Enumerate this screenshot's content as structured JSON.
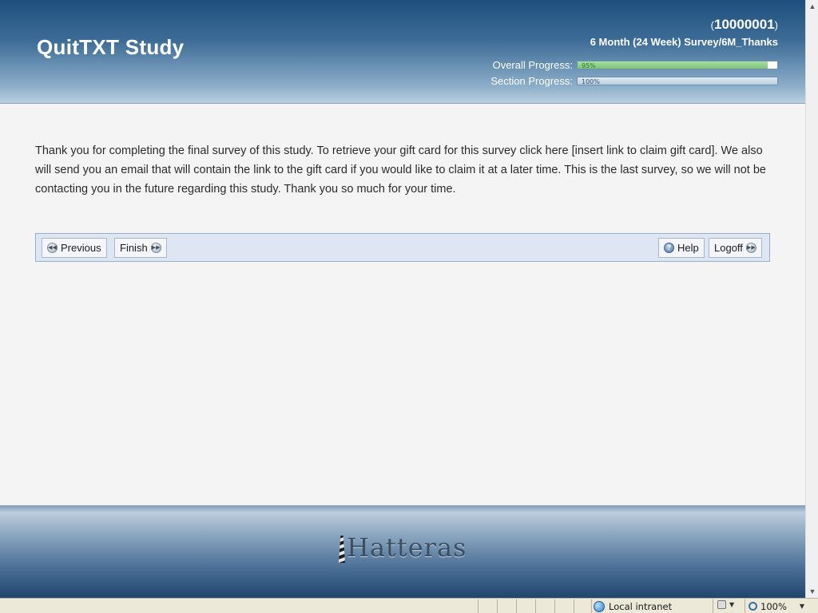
{
  "header": {
    "study_title": "QuitTXT Study",
    "participant_id": "10000001",
    "paren_open": "(",
    "paren_close": ")",
    "survey_name": "6 Month (24 Week) Survey/6M_Thanks",
    "overall_progress_label": "Overall Progress:",
    "overall_progress_value": 0.95,
    "overall_progress_text": "95%",
    "section_progress_label": "Section Progress:",
    "section_progress_value": 1.0,
    "section_progress_text": "100%"
  },
  "main": {
    "message": "Thank you for completing the final survey of this study. To retrieve your gift card for this survey click here [insert link to claim gift card]. We also will send you an email that will contain the link to the gift card if you would like to claim it at a later time. This is the last survey, so we will not be contacting you in the future regarding this study. Thank you so much for your time."
  },
  "nav": {
    "previous_label": "Previous",
    "finish_label": "Finish",
    "help_label": "Help",
    "logoff_label": "Logoff"
  },
  "footer": {
    "logo_text": "Hatteras"
  },
  "statusbar": {
    "zone_label": "Local intranet",
    "zoom_label": "100%"
  },
  "icons": {
    "previous": "rewind-circle-icon",
    "finish": "fast-forward-circle-icon",
    "help": "question-circle-icon",
    "logoff": "fast-forward-circle-icon",
    "zone": "globe-icon",
    "protected_mode": "lock-icon",
    "zoom": "magnifier-icon"
  },
  "colors": {
    "header_top": "#1e4f7c",
    "overall_progress_fill": "#7cc477",
    "section_progress_fill": "#b9cddf",
    "nav_bar_background": "#dde6f2"
  }
}
